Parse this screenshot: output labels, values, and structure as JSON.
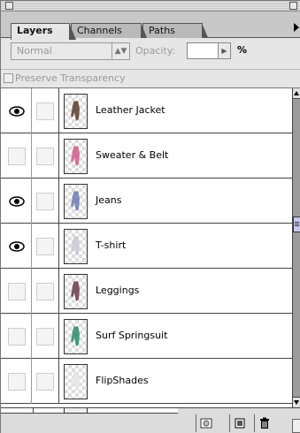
{
  "tabs": [
    {
      "label": "Layers",
      "active": true
    },
    {
      "label": "Channels",
      "active": false
    },
    {
      "label": "Paths",
      "active": false
    }
  ],
  "options": {
    "blend_mode": "Normal",
    "opacity_label": "Opacity:",
    "opacity_value": "",
    "percent_sign": "%",
    "preserve_label": "Preserve Transparency"
  },
  "layers": [
    {
      "name": "Leather Jacket",
      "visible": true,
      "thumb_color": "#5a3a2a"
    },
    {
      "name": "Sweater & Belt",
      "visible": false,
      "thumb_color": "#d05a8a"
    },
    {
      "name": "Jeans",
      "visible": true,
      "thumb_color": "#6a7ab0"
    },
    {
      "name": "T-shirt",
      "visible": true,
      "thumb_color": "#c9c9d8"
    },
    {
      "name": "Leggings",
      "visible": false,
      "thumb_color": "#6a3a4a"
    },
    {
      "name": "Surf Springsuit",
      "visible": false,
      "thumb_color": "#2a8a6a"
    },
    {
      "name": "FlipShades",
      "visible": false,
      "thumb_color": "#e6e6e6"
    }
  ],
  "icons": {
    "eye": "eye-icon",
    "mask": "layer-mask-icon",
    "new_layer": "new-layer-icon",
    "trash": "trash-icon",
    "palette_menu": "triangle-right-icon"
  }
}
